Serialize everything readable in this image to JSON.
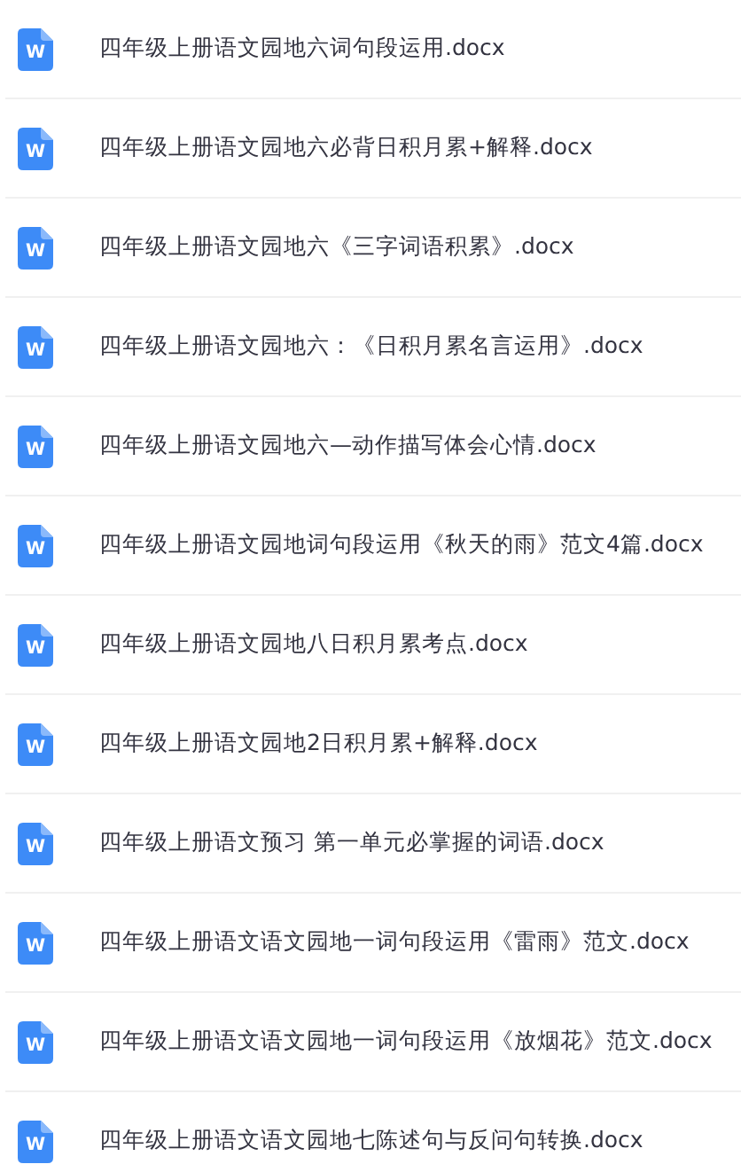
{
  "files": [
    {
      "name": "四年级上册语文园地六词句段运用.docx",
      "icon_text": "W"
    },
    {
      "name": "四年级上册语文园地六必背日积月累+解释.docx",
      "icon_text": "W"
    },
    {
      "name": "四年级上册语文园地六《三字词语积累》.docx",
      "icon_text": "W"
    },
    {
      "name": "四年级上册语文园地六：《日积月累名言运用》.docx",
      "icon_text": "W"
    },
    {
      "name": "四年级上册语文园地六—动作描写体会心情.docx",
      "icon_text": "W"
    },
    {
      "name": "四年级上册语文园地词句段运用《秋天的雨》范文4篇.docx",
      "icon_text": "W"
    },
    {
      "name": "四年级上册语文园地八日积月累考点.docx",
      "icon_text": "W"
    },
    {
      "name": "四年级上册语文园地2日积月累+解释.docx",
      "icon_text": "W"
    },
    {
      "name": "四年级上册语文预习 第一单元必掌握的词语.docx",
      "icon_text": "W"
    },
    {
      "name": "四年级上册语文语文园地一词句段运用《雷雨》范文.docx",
      "icon_text": "W"
    },
    {
      "name": "四年级上册语文语文园地一词句段运用《放烟花》范文.docx",
      "icon_text": "W"
    },
    {
      "name": "四年级上册语文语文园地七陈述句与反问句转换.docx",
      "icon_text": "W"
    }
  ]
}
